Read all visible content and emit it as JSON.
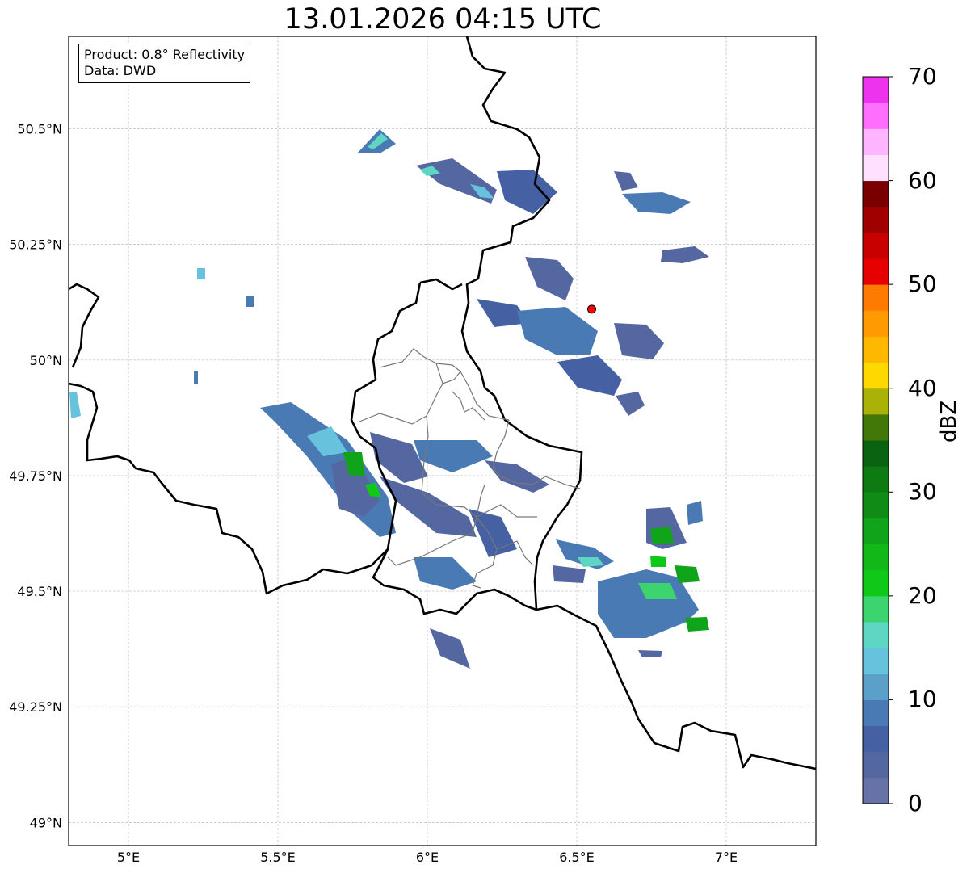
{
  "title": "13.01.2026 04:15 UTC",
  "info": {
    "product": "Product: 0.8° Reflectivity",
    "data": "Data: DWD"
  },
  "map": {
    "lon_ticks": [
      {
        "value": 5.0,
        "label": "5°E"
      },
      {
        "value": 5.5,
        "label": "5.5°E"
      },
      {
        "value": 6.0,
        "label": "6°E"
      },
      {
        "value": 6.5,
        "label": "6.5°E"
      },
      {
        "value": 7.0,
        "label": "7°E"
      }
    ],
    "lat_ticks": [
      {
        "value": 50.5,
        "label": "50.5°N"
      },
      {
        "value": 50.25,
        "label": "50.25°N"
      },
      {
        "value": 50.0,
        "label": "50°N"
      },
      {
        "value": 49.75,
        "label": "49.75°N"
      },
      {
        "value": 49.5,
        "label": "49.5°N"
      },
      {
        "value": 49.25,
        "label": "49.25°N"
      },
      {
        "value": 49.0,
        "label": "49°N"
      }
    ],
    "extent": {
      "lon": [
        4.8,
        7.3
      ],
      "lat": [
        48.95,
        50.7
      ]
    },
    "radar_site": {
      "lon": 6.55,
      "lat": 50.11,
      "color": "#ff0000"
    },
    "grid": true
  },
  "colorbar": {
    "label": "dBZ",
    "min": 0,
    "max": 70,
    "ticks": [
      "0",
      "10",
      "20",
      "30",
      "40",
      "50",
      "60",
      "70"
    ],
    "colors": [
      "#6672a8",
      "#5567a0",
      "#4560a3",
      "#4a7ab4",
      "#5aa0c8",
      "#66c2dd",
      "#5ed6c4",
      "#3cd46e",
      "#10c818",
      "#12b818",
      "#10a41a",
      "#108c16",
      "#0d7a12",
      "#0a6310",
      "#417808",
      "#aab208",
      "#ffd800",
      "#ffb800",
      "#ff9a00",
      "#ff7a00",
      "#e60000",
      "#c80000",
      "#a00000",
      "#7a0000",
      "#ffe0ff",
      "#ffb4ff",
      "#ff6eff",
      "#ee33ee"
    ]
  }
}
